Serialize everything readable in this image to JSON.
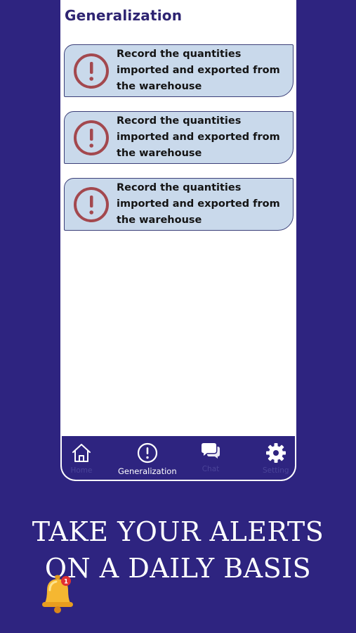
{
  "header": {
    "title": "Generalization"
  },
  "alerts": [
    {
      "text": "Record the quantities imported and exported from the warehouse",
      "icon": "exclamation-circle-icon"
    },
    {
      "text": "Record the quantities imported and exported from the warehouse",
      "icon": "exclamation-circle-icon"
    },
    {
      "text": "Record the quantities imported and exported from the warehouse",
      "icon": "exclamation-circle-icon"
    }
  ],
  "nav": {
    "items": [
      {
        "label": "Home",
        "icon": "home-icon",
        "active": false
      },
      {
        "label": "Generalization",
        "icon": "exclamation-circle-icon",
        "active": true
      },
      {
        "label": "Chat",
        "icon": "chat-bubbles-icon",
        "active": false
      },
      {
        "label": "Setting",
        "icon": "gear-icon",
        "active": false
      }
    ]
  },
  "promo": {
    "line1": "TAKE YOUR ALERTS",
    "line2": "ON A DAILY BASIS",
    "bell_badge": "1"
  },
  "colors": {
    "background": "#2e2480",
    "card_fill": "#c9d9eb",
    "card_border": "#3b3f78",
    "alert_icon": "#a3484e",
    "title": "#2e2472",
    "nav_inactive": "#4a4398",
    "bell": "#f5b731",
    "badge": "#e23030"
  }
}
